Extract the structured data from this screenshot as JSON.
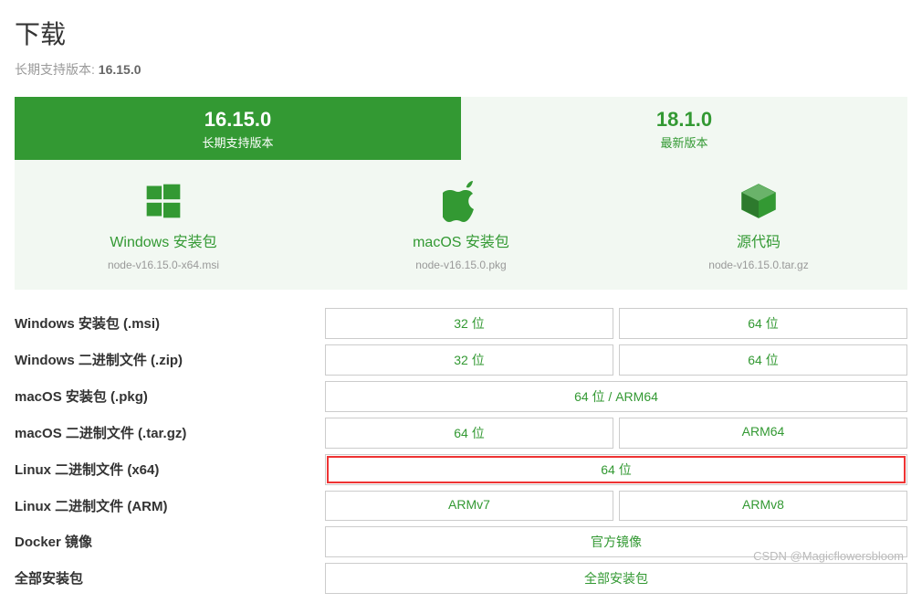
{
  "header": {
    "title": "下载",
    "subtitle_prefix": "长期支持版本: ",
    "lts_version": "16.15.0"
  },
  "tabs": {
    "lts": {
      "version": "16.15.0",
      "label": "长期支持版本"
    },
    "current": {
      "version": "18.1.0",
      "label": "最新版本"
    }
  },
  "platforms": {
    "windows": {
      "label": "Windows 安装包",
      "file": "node-v16.15.0-x64.msi"
    },
    "macos": {
      "label": "macOS 安装包",
      "file": "node-v16.15.0.pkg"
    },
    "source": {
      "label": "源代码",
      "file": "node-v16.15.0.tar.gz"
    }
  },
  "downloads": [
    {
      "label": "Windows 安装包 (.msi)",
      "links": [
        "32 位",
        "64 位"
      ]
    },
    {
      "label": "Windows 二进制文件 (.zip)",
      "links": [
        "32 位",
        "64 位"
      ]
    },
    {
      "label": "macOS 安装包 (.pkg)",
      "links": [
        "64 位 / ARM64"
      ]
    },
    {
      "label": "macOS 二进制文件 (.tar.gz)",
      "links": [
        "64 位",
        "ARM64"
      ]
    },
    {
      "label": "Linux 二进制文件 (x64)",
      "links": [
        "64 位"
      ],
      "highlight": [
        0
      ]
    },
    {
      "label": "Linux 二进制文件 (ARM)",
      "links": [
        "ARMv7",
        "ARMv8"
      ]
    },
    {
      "label": "Docker 镜像",
      "links": [
        "官方镜像"
      ]
    },
    {
      "label": "全部安装包",
      "links": [
        "全部安装包"
      ]
    }
  ],
  "watermark": "CSDN @Magicflowersbloom"
}
